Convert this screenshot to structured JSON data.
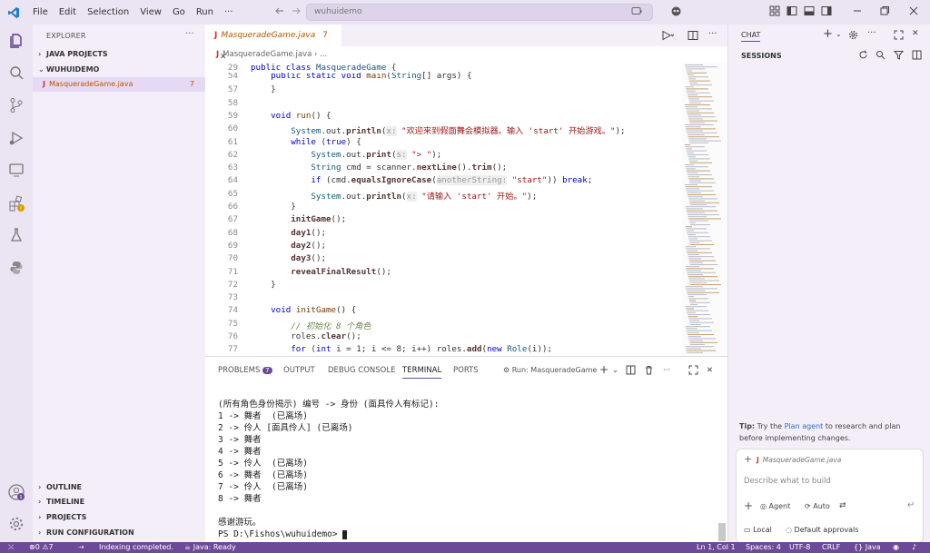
{
  "titlebar": {
    "menus": [
      "File",
      "Edit",
      "Selection",
      "View",
      "Go",
      "Run",
      "···"
    ],
    "search_text": "wuhuidemo"
  },
  "sidebar": {
    "title": "EXPLORER",
    "more": "···",
    "java_projects": "JAVA PROJECTS",
    "folder": "WUHUIDEMO",
    "file": "MasqueradeGame.java",
    "file_badge": "7",
    "outline": "OUTLINE",
    "timeline": "TIMELINE",
    "projects": "PROJECTS",
    "run_config": "RUN CONFIGURATION"
  },
  "editor": {
    "tab_label": "MasqueradeGame.java",
    "tab_count": "7",
    "breadcrumb_file": "MasqueradeGame.java",
    "breadcrumb_rest": "› ..."
  },
  "code": [
    {
      "n": "29",
      "html": "<span class='kw'>public class</span> <span class='ty'>MasqueradeGame</span> {"
    },
    {
      "n": "54",
      "html": "    <span class='kw'>public static void</span> <span class='fn'>main</span>(<span class='ty'>String</span>[] args) {"
    },
    {
      "n": "57",
      "html": "    }"
    },
    {
      "n": "58",
      "html": ""
    },
    {
      "n": "59",
      "html": "    <span class='kw'>void</span> <span class='fn'>run</span>() {"
    },
    {
      "n": "60",
      "html": "        <span class='ty'>System</span>.out.<span class='fnb'>println</span>(<span class='hint'>x:</span> <span class='st'>\"欢迎来到假面舞会模拟器。输入 'start' 开始游戏。\"</span>);"
    },
    {
      "n": "61",
      "html": "        <span class='kw'>while</span> (<span class='kw'>true</span>) {"
    },
    {
      "n": "62",
      "html": "            <span class='ty'>System</span>.out.<span class='fnb'>print</span>(<span class='hint'>s:</span> <span class='st'>\"> \"</span>);"
    },
    {
      "n": "63",
      "html": "            <span class='ty'>String</span> cmd = scanner.<span class='fnb'>nextLine</span>().<span class='fnb'>trim</span>();"
    },
    {
      "n": "64",
      "html": "            <span class='kw'>if</span> (cmd.<span class='fnb'>equalsIgnoreCase</span>(<span class='hint'>anotherString:</span> <span class='st'>\"start\"</span>)) <span class='kw'>break</span>;"
    },
    {
      "n": "65",
      "html": "            <span class='ty'>System</span>.out.<span class='fnb'>println</span>(<span class='hint'>x:</span> <span class='st'>\"请输入 'start' 开始。\"</span>);"
    },
    {
      "n": "66",
      "html": "        }"
    },
    {
      "n": "67",
      "html": "        <span class='fnb'>initGame</span>();"
    },
    {
      "n": "68",
      "html": "        <span class='fnb'>day1</span>();"
    },
    {
      "n": "69",
      "html": "        <span class='fnb'>day2</span>();"
    },
    {
      "n": "70",
      "html": "        <span class='fnb'>day3</span>();"
    },
    {
      "n": "71",
      "html": "        <span class='fnb'>revealFinalResult</span>();"
    },
    {
      "n": "72",
      "html": "    }"
    },
    {
      "n": "73",
      "html": ""
    },
    {
      "n": "74",
      "html": "    <span class='kw'>void</span> <span class='fn'>initGame</span>() {"
    },
    {
      "n": "75",
      "html": "        <span class='cm'>// 初始化 8 个角色</span>"
    },
    {
      "n": "76",
      "html": "        roles.<span class='fnb'>clear</span>();"
    },
    {
      "n": "77",
      "html": "        <span class='kw'>for</span> (<span class='kw'>int</span> i = 1; i &lt;= 8; i++) roles.<span class='fnb'>add</span>(<span class='kw'>new</span> <span class='ty'>Role</span>(i));"
    }
  ],
  "panel": {
    "tabs": [
      "PROBLEMS",
      "OUTPUT",
      "DEBUG CONSOLE",
      "TERMINAL",
      "PORTS"
    ],
    "problems_badge": "7",
    "run_label": "Run: MasqueradeGame",
    "terminal_lines": [
      "(所有角色身份揭示) 编号 -> 身份 (面具伶人有标记):",
      "1 -> 舞者  (已离场)",
      "2 -> 伶人 [面具伶人] (已离场)",
      "3 -> 舞者",
      "4 -> 舞者",
      "5 -> 伶人  (已离场)",
      "6 -> 舞者  (已离场)",
      "7 -> 伶人  (已离场)",
      "8 -> 舞者",
      "",
      "感谢游玩。",
      "PS D:\\Fishos\\wuhuidemo> "
    ]
  },
  "chat": {
    "title": "CHAT",
    "sessions": "SESSIONS",
    "tip_prefix": "Tip:",
    "tip_mid": " Try the ",
    "tip_link": "Plan agent",
    "tip_rest": " to research and plan before implementing changes.",
    "attached_file": "MasqueradeGame.java",
    "placeholder": "Describe what to build",
    "agent": "Agent",
    "auto": "Auto",
    "local": "Local",
    "approvals": "Default approvals"
  },
  "status": {
    "problems": "0",
    "warnings": "7",
    "indexing": "Indexing completed.",
    "java": "Java: Ready",
    "position": "Ln 1, Col 1",
    "spaces": "Spaces: 4",
    "encoding": "UTF-8",
    "eol": "CRLF",
    "language": "Java"
  },
  "colors": {
    "accent": "#6c4a98",
    "link": "#2a6fc9"
  }
}
